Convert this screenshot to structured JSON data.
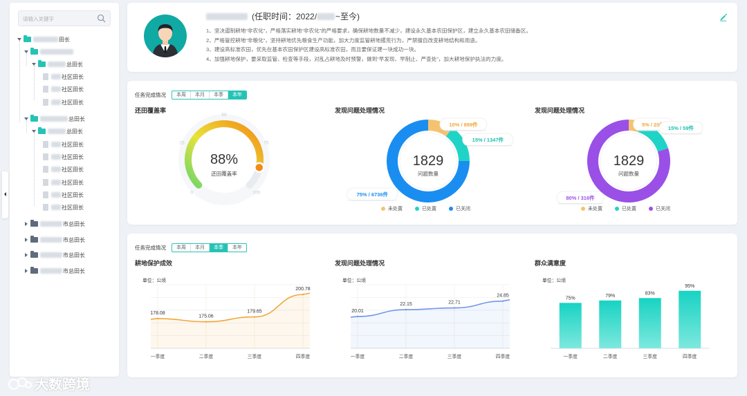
{
  "sidebar": {
    "search_placeholder": "请输入关键字",
    "tree": {
      "root_suffix": "田长",
      "l1_suffix": "",
      "group1_suffix": "总田长",
      "community": "社区田长",
      "group2_l1_suffix": "总田长",
      "group2_l2_suffix": "总田长",
      "city_suffix": "市总田长"
    }
  },
  "profile": {
    "title_prefix": "(任职时间：2022/",
    "title_suffix": "~至今)",
    "duties": [
      "1、坚决遏制耕地“非农化”，严格落实耕地“非农化”的严格要求，确保耕地数量不减少，建设永久基本农田保护区，建立永久基本农田储备区。",
      "2、严格管控耕地“非粮化”，坚持耕地优先粮食生产功能，加大力度监管耕地撂荒行为，严禁擅自改变耕地结构和用途。",
      "3、建设高标准农田，优先在基本农田保护区建设高标准农田，而且要保证建一块成功一块。",
      "4、加强耕地保护，要采取监管、检查等手段，对乱占耕地及时预警，做到“早发现、早制止、严查处”，加大耕地保护执法的力度。"
    ]
  },
  "section1": {
    "tabs_label": "任务完成情况",
    "tabs": [
      "本周",
      "本月",
      "本季",
      "本年"
    ],
    "active_tab": "本年",
    "gauge": {
      "title": "还田覆盖率",
      "value_text": "88%",
      "value": 88,
      "label": "还田覆盖率",
      "ticks": [
        "0",
        "25",
        "50",
        "75",
        "100"
      ]
    },
    "donut1": {
      "title": "发现问题处理情况",
      "total": "1829",
      "center_label": "问题数量",
      "segments": [
        {
          "name": "未处置",
          "value": 10,
          "label": "10% / 899件",
          "color": "#f5c36f"
        },
        {
          "name": "已处置",
          "value": 15,
          "label": "15% / 1347件",
          "color": "#1fd4c6"
        },
        {
          "name": "已关闭",
          "value": 75,
          "label": "75% / 6736件",
          "color": "#1a8ef0"
        }
      ]
    },
    "donut2": {
      "title": "发现问题处理情况",
      "total": "1829",
      "center_label": "问题数量",
      "segments": [
        {
          "name": "未处置",
          "value": 5,
          "label": "5% / 20件",
          "color": "#f5c36f"
        },
        {
          "name": "已处置",
          "value": 15,
          "label": "15% / 59件",
          "color": "#1fd4c6"
        },
        {
          "name": "已关闭",
          "value": 80,
          "label": "80% / 316件",
          "color": "#9a50e6"
        }
      ]
    }
  },
  "section2": {
    "tabs_label": "任务完成情况",
    "tabs": [
      "本周",
      "本月",
      "本季",
      "本年"
    ],
    "active_tab": "本季",
    "unit": "单位：公顷",
    "chart1_title": "耕地保护成效",
    "chart2_title": "发现问题处理情况",
    "chart3_title": "群众满意度"
  },
  "chart_data": [
    {
      "type": "area",
      "title": "耕地保护成效",
      "categories": [
        "一季度",
        "二季度",
        "三季度",
        "四季度"
      ],
      "values": [
        178.08,
        175.06,
        179.65,
        200.78
      ],
      "data_labels": [
        "178.08",
        "175.06",
        "179.65",
        "200.78"
      ],
      "color": "#f0a63a",
      "ylabel": "单位：公顷"
    },
    {
      "type": "area",
      "title": "发现问题处理情况",
      "categories": [
        "一季度",
        "二季度",
        "三季度",
        "四季度"
      ],
      "values": [
        20.01,
        22.15,
        22.71,
        24.85
      ],
      "data_labels": [
        "20.01",
        "22.15",
        "22.71",
        "24.85"
      ],
      "color": "#6f96e6",
      "ylabel": "单位：公顷"
    },
    {
      "type": "bar",
      "title": "群众满意度",
      "categories": [
        "一季度",
        "二季度",
        "三季度",
        "四季度"
      ],
      "values": [
        75,
        79,
        83,
        95
      ],
      "data_labels": [
        "75%",
        "79%",
        "83%",
        "95%"
      ],
      "color": "#1fd4c6",
      "ylabel": "单位：公顷"
    }
  ],
  "watermark": "大数跨境"
}
